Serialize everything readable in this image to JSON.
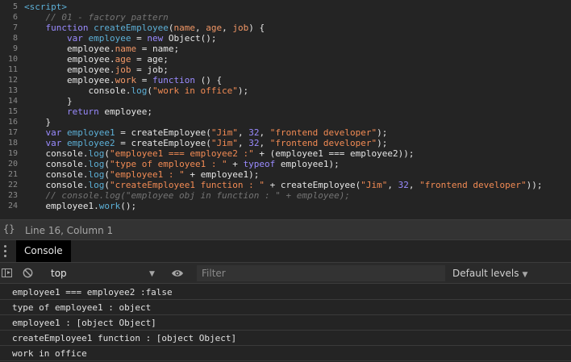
{
  "editor": {
    "lines": [
      {
        "number": "5",
        "tokens": [
          {
            "t": "<script>",
            "c": "tag"
          }
        ]
      },
      {
        "number": "6",
        "tokens": [
          {
            "t": "    // 01 - factory pattern",
            "c": "com"
          }
        ]
      },
      {
        "number": "7",
        "tokens": [
          {
            "t": "    ",
            "c": "default"
          },
          {
            "t": "function ",
            "c": "kw"
          },
          {
            "t": "createEmployee",
            "c": "fn"
          },
          {
            "t": "(",
            "c": "default"
          },
          {
            "t": "name",
            "c": "prop"
          },
          {
            "t": ", ",
            "c": "default"
          },
          {
            "t": "age",
            "c": "prop"
          },
          {
            "t": ", ",
            "c": "default"
          },
          {
            "t": "job",
            "c": "prop"
          },
          {
            "t": ") {",
            "c": "default"
          }
        ]
      },
      {
        "number": "8",
        "tokens": [
          {
            "t": "        ",
            "c": "default"
          },
          {
            "t": "var ",
            "c": "kw"
          },
          {
            "t": "employee",
            "c": "fn"
          },
          {
            "t": " = ",
            "c": "default"
          },
          {
            "t": "new ",
            "c": "kw"
          },
          {
            "t": "Object();",
            "c": "default"
          }
        ]
      },
      {
        "number": "9",
        "tokens": [
          {
            "t": "        employee.",
            "c": "default"
          },
          {
            "t": "name",
            "c": "prop"
          },
          {
            "t": " = name;",
            "c": "default"
          }
        ]
      },
      {
        "number": "10",
        "tokens": [
          {
            "t": "        employee.",
            "c": "default"
          },
          {
            "t": "age",
            "c": "prop"
          },
          {
            "t": " = age;",
            "c": "default"
          }
        ]
      },
      {
        "number": "11",
        "tokens": [
          {
            "t": "        employee.",
            "c": "default"
          },
          {
            "t": "job",
            "c": "prop"
          },
          {
            "t": " = job;",
            "c": "default"
          }
        ]
      },
      {
        "number": "12",
        "tokens": [
          {
            "t": "        employee.",
            "c": "default"
          },
          {
            "t": "work",
            "c": "prop"
          },
          {
            "t": " = ",
            "c": "default"
          },
          {
            "t": "function",
            "c": "kw"
          },
          {
            "t": " () {",
            "c": "default"
          }
        ]
      },
      {
        "number": "13",
        "tokens": [
          {
            "t": "            console.",
            "c": "default"
          },
          {
            "t": "log",
            "c": "fn"
          },
          {
            "t": "(",
            "c": "default"
          },
          {
            "t": "\"work in office\"",
            "c": "str"
          },
          {
            "t": ");",
            "c": "default"
          }
        ]
      },
      {
        "number": "14",
        "tokens": [
          {
            "t": "        }",
            "c": "default"
          }
        ]
      },
      {
        "number": "15",
        "tokens": [
          {
            "t": "        ",
            "c": "default"
          },
          {
            "t": "return ",
            "c": "kw"
          },
          {
            "t": "employee;",
            "c": "default"
          }
        ]
      },
      {
        "number": "16",
        "tokens": [
          {
            "t": "    }",
            "c": "default"
          }
        ]
      },
      {
        "number": "17",
        "tokens": [
          {
            "t": "    ",
            "c": "default"
          },
          {
            "t": "var ",
            "c": "kw"
          },
          {
            "t": "employee1",
            "c": "fn"
          },
          {
            "t": " = createEmployee(",
            "c": "default"
          },
          {
            "t": "\"Jim\"",
            "c": "str"
          },
          {
            "t": ", ",
            "c": "default"
          },
          {
            "t": "32",
            "c": "num"
          },
          {
            "t": ", ",
            "c": "default"
          },
          {
            "t": "\"frontend developer\"",
            "c": "str"
          },
          {
            "t": ");",
            "c": "default"
          }
        ]
      },
      {
        "number": "18",
        "tokens": [
          {
            "t": "    ",
            "c": "default"
          },
          {
            "t": "var ",
            "c": "kw"
          },
          {
            "t": "employee2",
            "c": "fn"
          },
          {
            "t": " = createEmployee(",
            "c": "default"
          },
          {
            "t": "\"Jim\"",
            "c": "str"
          },
          {
            "t": ", ",
            "c": "default"
          },
          {
            "t": "32",
            "c": "num"
          },
          {
            "t": ", ",
            "c": "default"
          },
          {
            "t": "\"frontend developer\"",
            "c": "str"
          },
          {
            "t": ");",
            "c": "default"
          }
        ]
      },
      {
        "number": "19",
        "tokens": [
          {
            "t": "    console.",
            "c": "default"
          },
          {
            "t": "log",
            "c": "fn"
          },
          {
            "t": "(",
            "c": "default"
          },
          {
            "t": "\"employee1 === employee2 :\"",
            "c": "str"
          },
          {
            "t": " + (employee1 === employee2));",
            "c": "default"
          }
        ]
      },
      {
        "number": "20",
        "tokens": [
          {
            "t": "    console.",
            "c": "default"
          },
          {
            "t": "log",
            "c": "fn"
          },
          {
            "t": "(",
            "c": "default"
          },
          {
            "t": "\"type of employee1 : \"",
            "c": "str"
          },
          {
            "t": " + ",
            "c": "default"
          },
          {
            "t": "typeof ",
            "c": "kw"
          },
          {
            "t": "employee1);",
            "c": "default"
          }
        ]
      },
      {
        "number": "21",
        "tokens": [
          {
            "t": "    console.",
            "c": "default"
          },
          {
            "t": "log",
            "c": "fn"
          },
          {
            "t": "(",
            "c": "default"
          },
          {
            "t": "\"employee1 : \"",
            "c": "str"
          },
          {
            "t": " + employee1);",
            "c": "default"
          }
        ]
      },
      {
        "number": "22",
        "tokens": [
          {
            "t": "    console.",
            "c": "default"
          },
          {
            "t": "log",
            "c": "fn"
          },
          {
            "t": "(",
            "c": "default"
          },
          {
            "t": "\"createEmployee1 function : \"",
            "c": "str"
          },
          {
            "t": " + createEmployee(",
            "c": "default"
          },
          {
            "t": "\"Jim\"",
            "c": "str"
          },
          {
            "t": ", ",
            "c": "default"
          },
          {
            "t": "32",
            "c": "num"
          },
          {
            "t": ", ",
            "c": "default"
          },
          {
            "t": "\"frontend developer\"",
            "c": "str"
          },
          {
            "t": "));",
            "c": "default"
          }
        ]
      },
      {
        "number": "23",
        "tokens": [
          {
            "t": "    // console.log(\"employee obj in function : \" + employee);",
            "c": "com"
          }
        ]
      },
      {
        "number": "24",
        "tokens": [
          {
            "t": "    employee1.",
            "c": "default"
          },
          {
            "t": "work",
            "c": "fn"
          },
          {
            "t": "();",
            "c": "default"
          }
        ]
      }
    ]
  },
  "status_bar": {
    "braces": "{}",
    "text": "Line 16, Column 1"
  },
  "drawer": {
    "console_tab_label": "Console"
  },
  "toolbar": {
    "context": "top",
    "filter_placeholder": "Filter",
    "levels": "Default levels"
  },
  "console_messages": [
    "employee1 === employee2 :false",
    "type of employee1 : object",
    "employee1 : [object Object]",
    "createEmployee1 function : [object Object]",
    "work in office"
  ],
  "icons": {
    "sidebar": "sidebar-toggle-icon",
    "clear": "clear-console-icon",
    "eye": "eye-icon",
    "menu": "kebab-menu-icon"
  },
  "colors": {
    "background": "#242424",
    "tag": "#5db0d7",
    "keyword": "#9a8bff",
    "string": "#f28b54",
    "comment": "#747474"
  }
}
